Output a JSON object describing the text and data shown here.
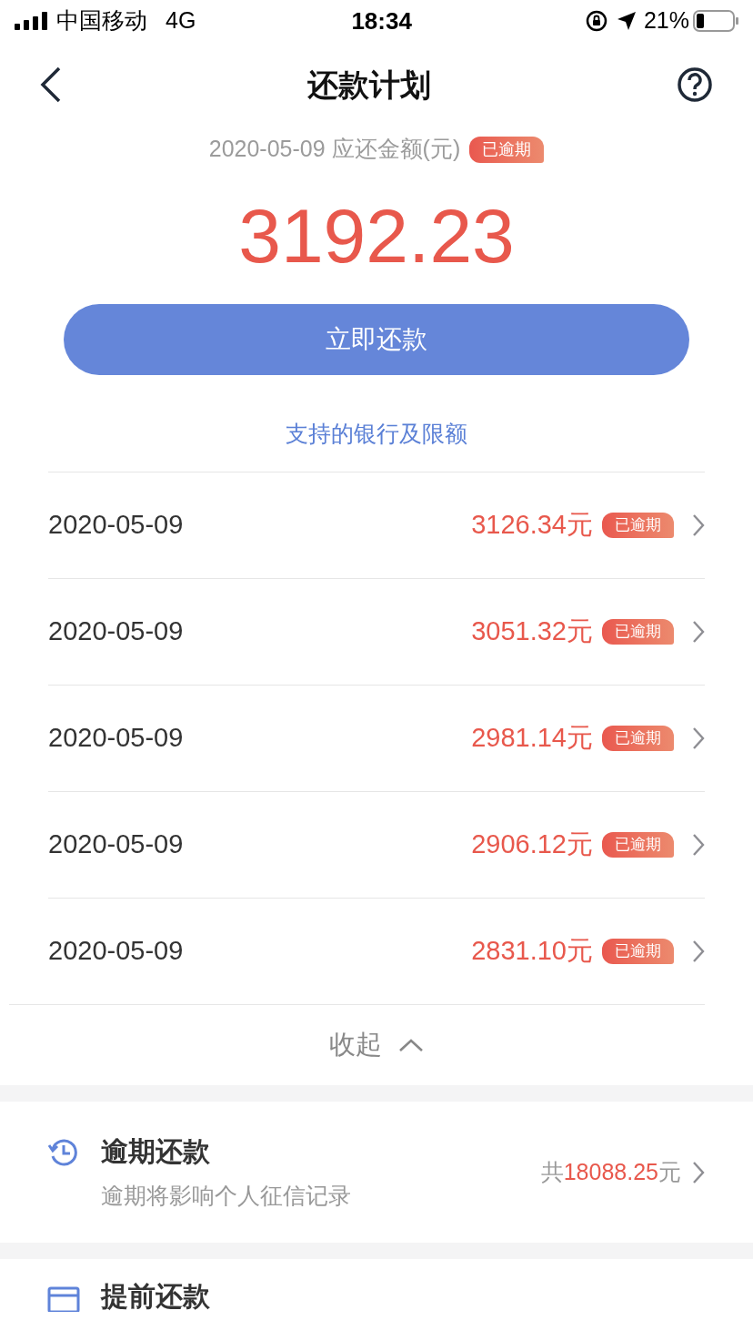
{
  "status_bar": {
    "carrier": "中国移动",
    "network": "4G",
    "time": "18:34",
    "battery": "21%"
  },
  "header": {
    "title": "还款计划"
  },
  "summary": {
    "date_label": "2020-05-09 应还金额(元)",
    "badge": "已逾期",
    "amount": "3192.23",
    "pay_button": "立即还款",
    "banks_link": "支持的银行及限额"
  },
  "installments": [
    {
      "date": "2020-05-09",
      "amount": "3126.34元",
      "badge": "已逾期"
    },
    {
      "date": "2020-05-09",
      "amount": "3051.32元",
      "badge": "已逾期"
    },
    {
      "date": "2020-05-09",
      "amount": "2981.14元",
      "badge": "已逾期"
    },
    {
      "date": "2020-05-09",
      "amount": "2906.12元",
      "badge": "已逾期"
    },
    {
      "date": "2020-05-09",
      "amount": "2831.10元",
      "badge": "已逾期"
    }
  ],
  "collapse": {
    "label": "收起",
    "expanded": true
  },
  "sections": [
    {
      "kind": "overdue",
      "title": "逾期还款",
      "subtitle": "逾期将影响个人征信记录",
      "total_prefix": "共",
      "total": "18088.25",
      "total_suffix": "元"
    },
    {
      "kind": "early",
      "title": "提前还款"
    }
  ]
}
